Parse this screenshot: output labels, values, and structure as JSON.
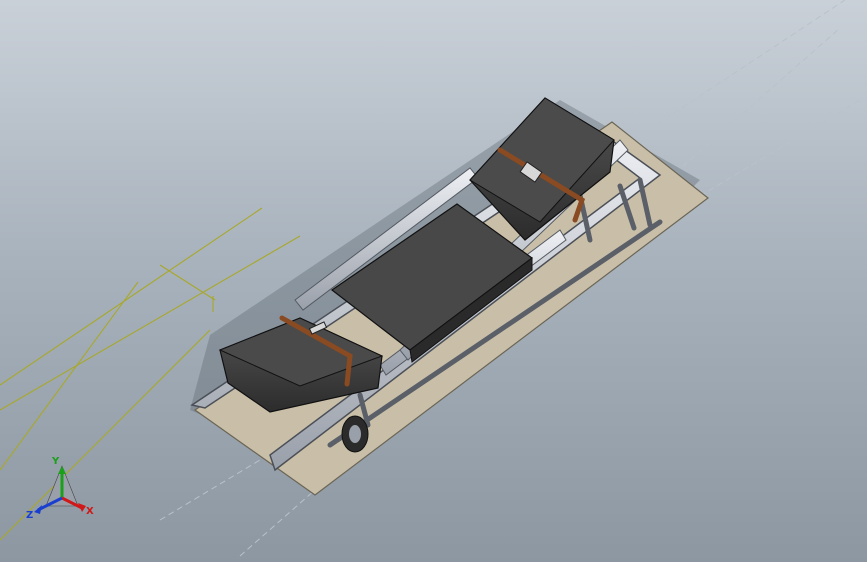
{
  "app": {
    "view": "isometric"
  },
  "model": {
    "name": "stretcher-assembly"
  },
  "triad": {
    "x_label": "X",
    "y_label": "Y",
    "z_label": "Z",
    "colors": {
      "x": "#d01818",
      "y": "#1aa01a",
      "z": "#1a3fd0"
    }
  },
  "colors": {
    "background_top": "#c9d0d8",
    "background_bottom": "#8d97a1",
    "mattress": "#3b3b3b",
    "frame": "#c8cad2",
    "strap": "#8a4a22",
    "base_plate": "#c9bfa8",
    "sketch_line": "#a8a82a"
  }
}
